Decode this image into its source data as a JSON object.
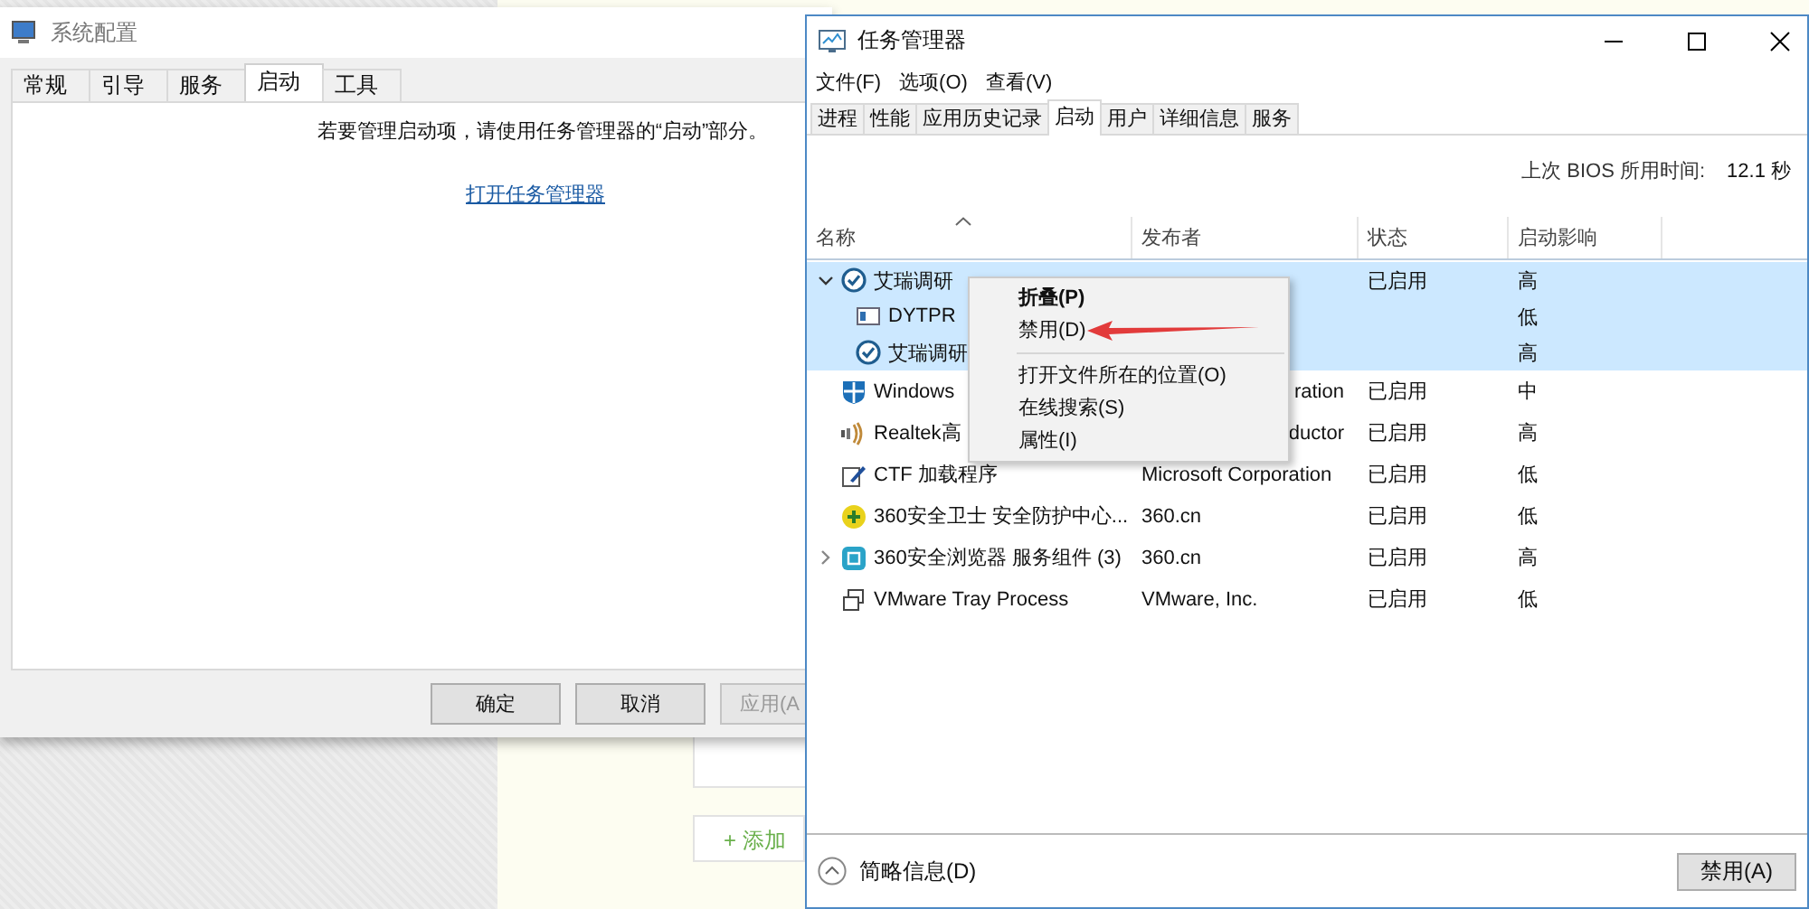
{
  "background_page": {
    "add_button": "+ 添加"
  },
  "system_config": {
    "title": "系统配置",
    "tabs": [
      {
        "label": "常规",
        "selected": false
      },
      {
        "label": "引导",
        "selected": false
      },
      {
        "label": "服务",
        "selected": false
      },
      {
        "label": "启动",
        "selected": true
      },
      {
        "label": "工具",
        "selected": false
      }
    ],
    "message": "若要管理启动项，请使用任务管理器的“启动”部分。",
    "link": "打开任务管理器",
    "buttons": [
      {
        "label": "确定",
        "disabled": false
      },
      {
        "label": "取消",
        "disabled": false
      },
      {
        "label": "应用(A",
        "disabled": true
      }
    ]
  },
  "task_manager": {
    "title": "任务管理器",
    "menu": [
      "文件(F)",
      "选项(O)",
      "查看(V)"
    ],
    "tabs": [
      {
        "label": "进程",
        "selected": false
      },
      {
        "label": "性能",
        "selected": false
      },
      {
        "label": "应用历史记录",
        "selected": false
      },
      {
        "label": "启动",
        "selected": true
      },
      {
        "label": "用户",
        "selected": false
      },
      {
        "label": "详细信息",
        "selected": false
      },
      {
        "label": "服务",
        "selected": false
      }
    ],
    "bios_label": "上次 BIOS 所用时间:",
    "bios_value": "12.1 秒",
    "columns": [
      "名称",
      "发布者",
      "状态",
      "启动影响"
    ],
    "rows": [
      {
        "name": "艾瑞调研",
        "status": "已启用",
        "impact": "高",
        "selected": true,
        "expanded": true,
        "covered": false,
        "children": [
          {
            "name": "DYTPR",
            "impact": "低",
            "selected": true,
            "covered": false
          },
          {
            "name": "艾瑞调研",
            "impact": "高",
            "selected": true,
            "covered": false
          }
        ]
      },
      {
        "name": "Windows",
        "publisher": "ration",
        "status": "已启用",
        "impact": "中",
        "selected": false,
        "covered": true
      },
      {
        "name": "Realtek高",
        "publisher": "ductor",
        "status": "已启用",
        "impact": "高",
        "selected": false,
        "covered": true
      },
      {
        "name": "CTF 加载程序",
        "publisher": "Microsoft Corporation",
        "status": "已启用",
        "impact": "低",
        "selected": false,
        "covered": false
      },
      {
        "name": "360安全卫士 安全防护中心...",
        "publisher": "360.cn",
        "status": "已启用",
        "impact": "低",
        "selected": false,
        "covered": false
      },
      {
        "name": "360安全浏览器 服务组件 (3)",
        "publisher": "360.cn",
        "status": "已启用",
        "impact": "高",
        "selected": false,
        "expanded": false,
        "covered": false,
        "children": []
      },
      {
        "name": "VMware Tray Process",
        "publisher": "VMware, Inc.",
        "status": "已启用",
        "impact": "低",
        "selected": false,
        "covered": false
      }
    ],
    "context_menu": [
      {
        "label": "折叠(P)",
        "kind": "default"
      },
      {
        "label": "禁用(D)",
        "kind": "item"
      },
      {
        "kind": "separator"
      },
      {
        "label": "打开文件所在的位置(O)",
        "kind": "item"
      },
      {
        "label": "在线搜索(S)",
        "kind": "item"
      },
      {
        "label": "属性(I)",
        "kind": "item"
      }
    ],
    "fewer_details": "简略信息(D)",
    "disable_button": "禁用(A)"
  }
}
